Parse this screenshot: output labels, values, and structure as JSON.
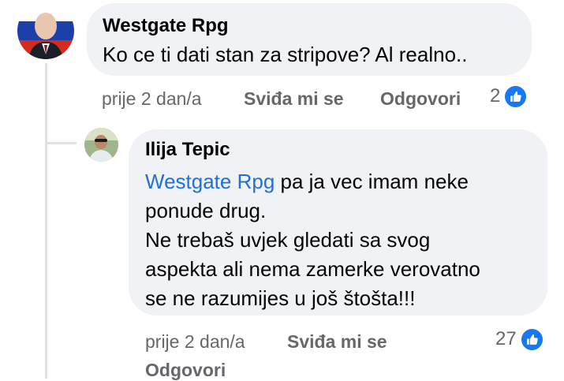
{
  "comment1": {
    "author": "Westgate Rpg",
    "text": "Ko ce ti dati stan za stripove? Al realno..",
    "time": "prije 2 dan/a",
    "like_label": "Sviđa mi se",
    "reply_label": "Odgovori",
    "like_count": "2"
  },
  "reply1": {
    "author": "Ilija Tepic",
    "mention": "Westgate Rpg",
    "line1_rest": " pa ja vec imam neke",
    "line2": "ponude drug.",
    "line3": "Ne trebaš uvjek gledati sa svog",
    "line4": "aspekta ali nema zamerke verovatno",
    "line5": "se ne razumijes u još štošta!!!",
    "time": "prije 2 dan/a",
    "like_label": "Sviđa mi se",
    "reply_label": "Odgovori",
    "like_count": "27"
  },
  "colors": {
    "bubble": "#f0f2f5",
    "mention": "#216fdb",
    "meta": "#65676b",
    "like_badge": "#1877f2"
  }
}
